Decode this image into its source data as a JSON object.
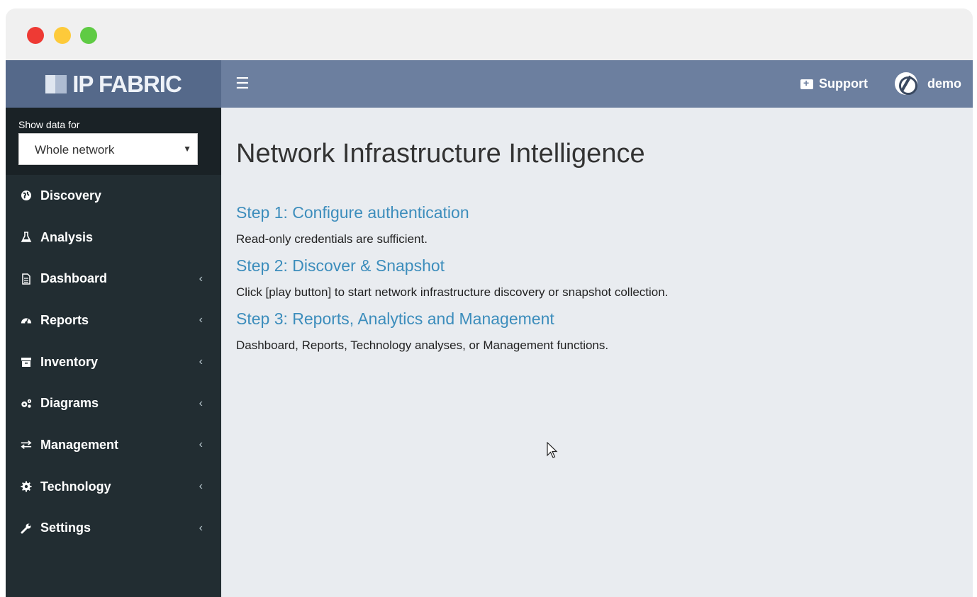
{
  "window": {
    "controls": [
      "close",
      "minimize",
      "maximize"
    ]
  },
  "brand": {
    "logo_text": "IP FABRIC",
    "header_color": "#55698a",
    "topbar_color": "#6c7f9f",
    "sidebar_color": "#222d32",
    "link_color": "#3c8dbc"
  },
  "topbar": {
    "menu_icon": "hamburger-icon",
    "support_label": "Support",
    "support_icon": "medkit-icon",
    "user_name": "demo",
    "user_icon": "avatar-icon"
  },
  "sidebar": {
    "filter_label": "Show data for",
    "filter_value": "Whole network",
    "items": [
      {
        "label": "Discovery",
        "icon": "globe-icon",
        "has_submenu": false
      },
      {
        "label": "Analysis",
        "icon": "flask-icon",
        "has_submenu": false
      },
      {
        "label": "Dashboard",
        "icon": "file-icon",
        "has_submenu": true
      },
      {
        "label": "Reports",
        "icon": "dashboard-icon",
        "has_submenu": true
      },
      {
        "label": "Inventory",
        "icon": "archive-icon",
        "has_submenu": true
      },
      {
        "label": "Diagrams",
        "icon": "cogs-icon",
        "has_submenu": true
      },
      {
        "label": "Management",
        "icon": "exchange-icon",
        "has_submenu": true
      },
      {
        "label": "Technology",
        "icon": "cog-icon",
        "has_submenu": true
      },
      {
        "label": "Settings",
        "icon": "wrench-icon",
        "has_submenu": true
      }
    ]
  },
  "main": {
    "title": "Network Infrastructure Intelligence",
    "steps": [
      {
        "title": "Step 1: Configure authentication",
        "text": "Read-only credentials are sufficient."
      },
      {
        "title": "Step 2: Discover & Snapshot",
        "text": "Click [play button] to start network infrastructure discovery or snapshot collection."
      },
      {
        "title": "Step 3: Reports, Analytics and Management",
        "text": "Dashboard, Reports, Technology analyses, or Management functions."
      }
    ]
  }
}
